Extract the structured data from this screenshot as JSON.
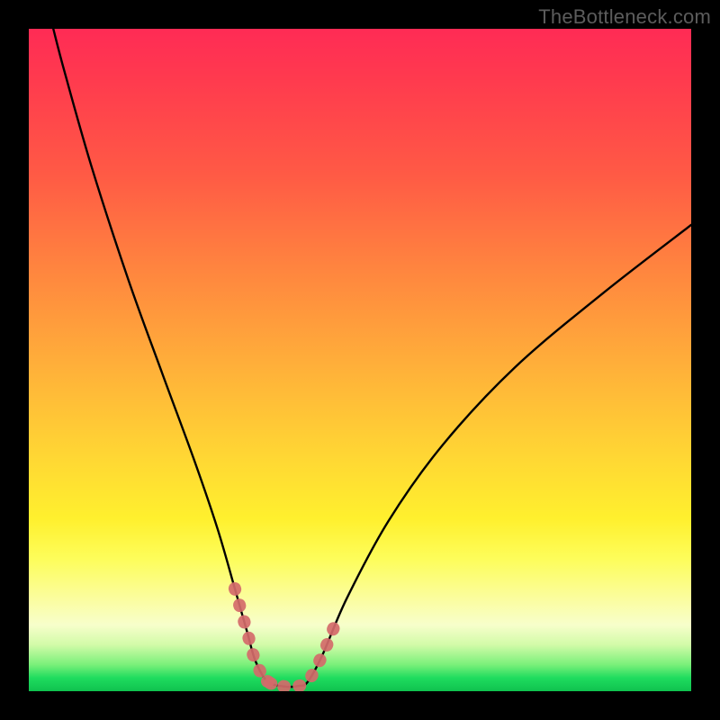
{
  "watermark": {
    "text": "TheBottleneck.com"
  },
  "colors": {
    "background": "#000000",
    "curve_stroke": "#000000",
    "highlight_stroke": "#d46a6a"
  },
  "chart_data": {
    "type": "line",
    "title": "",
    "xlabel": "",
    "ylabel": "",
    "xlim": [
      0,
      100
    ],
    "ylim": [
      0,
      100
    ],
    "grid": false,
    "legend": false,
    "note": "No axis ticks or numeric labels are rendered; values are estimated from pixel positions within the 736x736 plot area, origin at bottom-left.",
    "series": [
      {
        "name": "curve",
        "x": [
          3.7,
          5.4,
          9.5,
          15.0,
          20.1,
          25.0,
          28.5,
          31.1,
          33.0,
          34.2,
          36.0,
          38.6,
          40.8,
          42.1,
          44.3,
          48.0,
          54.3,
          62.5,
          73.4,
          86.7,
          100.0
        ],
        "y": [
          100.0,
          93.5,
          79.1,
          62.2,
          48.1,
          34.8,
          24.5,
          15.5,
          8.8,
          4.6,
          1.5,
          0.7,
          0.8,
          1.4,
          5.4,
          14.0,
          25.7,
          37.2,
          48.9,
          60.1,
          70.4
        ]
      }
    ],
    "highlight_segments": [
      {
        "name": "left-marker",
        "x": [
          31.1,
          33.0,
          34.2,
          36.0,
          38.6
        ],
        "y": [
          15.5,
          8.8,
          4.6,
          1.5,
          0.7
        ]
      },
      {
        "name": "bottom-marker",
        "x": [
          36.0,
          38.6,
          40.8
        ],
        "y": [
          1.5,
          0.7,
          0.8
        ]
      },
      {
        "name": "right-marker",
        "x": [
          40.8,
          42.1,
          44.3,
          46.2
        ],
        "y": [
          0.8,
          1.4,
          5.4,
          10.0
        ]
      }
    ]
  }
}
